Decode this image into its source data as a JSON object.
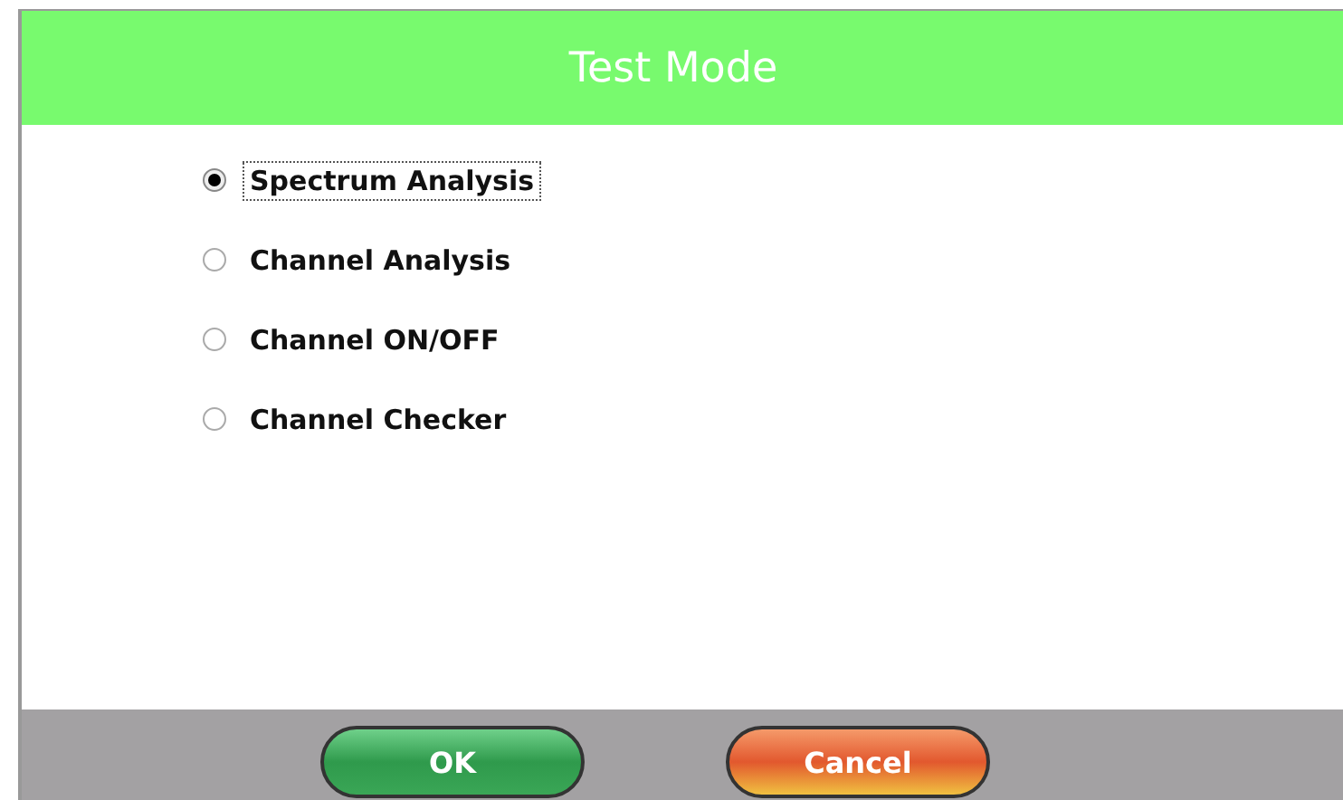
{
  "window": {
    "title": "Test Mode"
  },
  "options": [
    {
      "label": "Spectrum Analysis",
      "selected": true
    },
    {
      "label": "Channel Analysis",
      "selected": false
    },
    {
      "label": "Channel ON/OFF",
      "selected": false
    },
    {
      "label": "Channel Checker",
      "selected": false
    }
  ],
  "buttons": [
    {
      "label": "OK",
      "kind": "ok"
    },
    {
      "label": "Cancel",
      "kind": "cancel"
    }
  ]
}
